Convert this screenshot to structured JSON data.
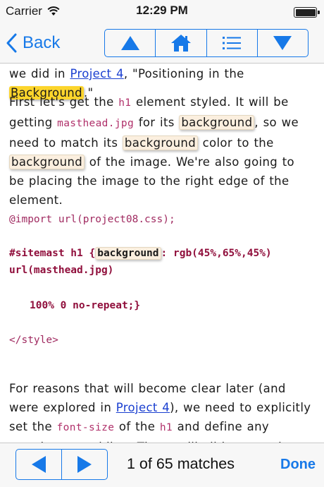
{
  "status_bar": {
    "carrier": "Carrier",
    "time": "12:29 PM"
  },
  "nav": {
    "back_label": "Back"
  },
  "content": {
    "line0": {
      "a": "we did in ",
      "link": "Project 4",
      "b": ", \"Positioning in the ",
      "hl": "Background",
      "c": ".\""
    },
    "para1": {
      "a": "First let's get the ",
      "code1": "h1",
      "b": " element styled. It will be getting ",
      "code2": "masthead.jpg",
      "c": " for its ",
      "hl1": "background",
      "d": ", so we need to match its ",
      "hl2": "background",
      "e": " color to the ",
      "hl3": "background",
      "f": " of the image. We're also going to be placing the image to the right edge of the element."
    },
    "code": {
      "import": "@import url(project08.css);",
      "rule_a": "#sitemast h1 {",
      "rule_hl": "background",
      "rule_b": ": rgb(45%,65%,45%)",
      "rule_c": "url(masthead.jpg)",
      "rule_d": "100% 0 no-repeat;}",
      "close_style": "</style>"
    },
    "para2": {
      "a": "For reasons that will become clear later (and were explored in ",
      "link": "Project 4",
      "b": "), we need to explicitly set the ",
      "code1": "font-size",
      "c": " of the ",
      "code2": "h1",
      "d": " and define any margins or padding. These will all be set using ems for the sake of"
    }
  },
  "bottom": {
    "match_text": "1 of 65 matches",
    "done_label": "Done"
  },
  "colors": {
    "accent": "#1779e8",
    "highlight_current": "#fcd52c",
    "highlight_other": "#fbefdf",
    "code_text": "#b0306a"
  },
  "icons": {
    "nav": [
      "chevron-left-icon",
      "triangle-up-icon",
      "home-icon",
      "list-icon",
      "triangle-down-icon"
    ],
    "bottom": [
      "triangle-left-icon",
      "triangle-right-icon"
    ],
    "status": [
      "wifi-icon",
      "battery-icon"
    ]
  }
}
